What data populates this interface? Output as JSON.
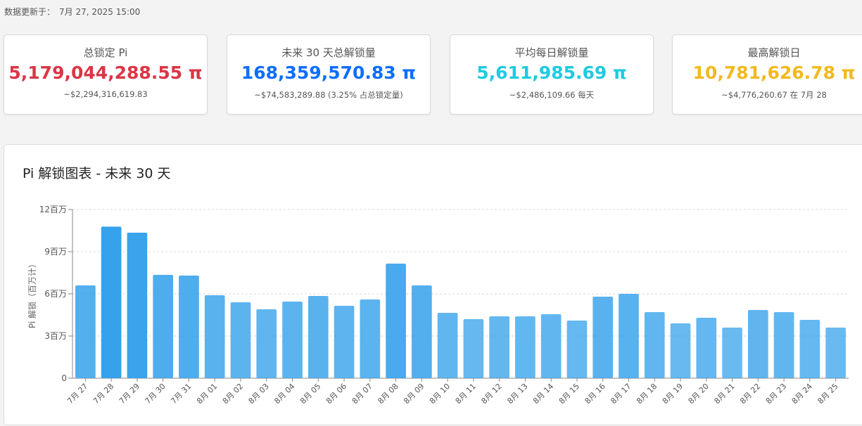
{
  "updated": {
    "label": "数据更新于：",
    "value": "7月 27, 2025 15:00"
  },
  "cards": [
    {
      "title": "总锁定 Pi",
      "value": "5,179,044,288.55 π",
      "sub": "~$2,294,316,619.83",
      "color": "#dc3545"
    },
    {
      "title": "未来 30 天总解锁量",
      "value": "168,359,570.83 π",
      "sub": "~$74,583,289.88 (3.25% 占总锁定量)",
      "color": "#0d6efd"
    },
    {
      "title": "平均每日解锁量",
      "value": "5,611,985.69 π",
      "sub": "~$2,486,109.66 每天",
      "color": "#1ecbe1"
    },
    {
      "title": "最高解锁日",
      "value": "10,781,626.78 π",
      "sub": "~$4,776,260.67 在 7月 28",
      "color": "#f2b91f"
    }
  ],
  "chart": {
    "title": "Pi 解锁图表 - 未来 30 天"
  },
  "chart_data": {
    "type": "bar",
    "title": "Pi 解锁图表 - 未来 30 天",
    "ylabel": "Pi 解锁（百万计）",
    "xlabel": "",
    "ylim": [
      0,
      12
    ],
    "yticks": [
      0,
      3,
      6,
      9,
      12
    ],
    "ytick_labels": [
      "0",
      "3百万",
      "6百万",
      "9百万",
      "12百万"
    ],
    "grid": true,
    "categories": [
      "7月 27",
      "7月 28",
      "7月 29",
      "7月 30",
      "7月 31",
      "8月 01",
      "8月 02",
      "8月 03",
      "8月 04",
      "8月 05",
      "8月 06",
      "8月 07",
      "8月 08",
      "8月 09",
      "8月 10",
      "8月 11",
      "8月 12",
      "8月 13",
      "8月 14",
      "8月 15",
      "8月 16",
      "8月 17",
      "8月 18",
      "8月 19",
      "8月 20",
      "8月 21",
      "8月 22",
      "8月 23",
      "8月 24",
      "8月 25"
    ],
    "values": [
      6.6,
      10.78,
      10.35,
      7.35,
      7.3,
      5.9,
      5.4,
      4.9,
      5.45,
      5.85,
      5.15,
      5.6,
      8.15,
      6.6,
      4.65,
      4.2,
      4.4,
      4.4,
      4.55,
      4.1,
      5.8,
      6.0,
      4.7,
      3.9,
      4.3,
      3.6,
      4.85,
      4.7,
      4.15,
      3.6
    ],
    "bar_color": "#36a2eb"
  }
}
